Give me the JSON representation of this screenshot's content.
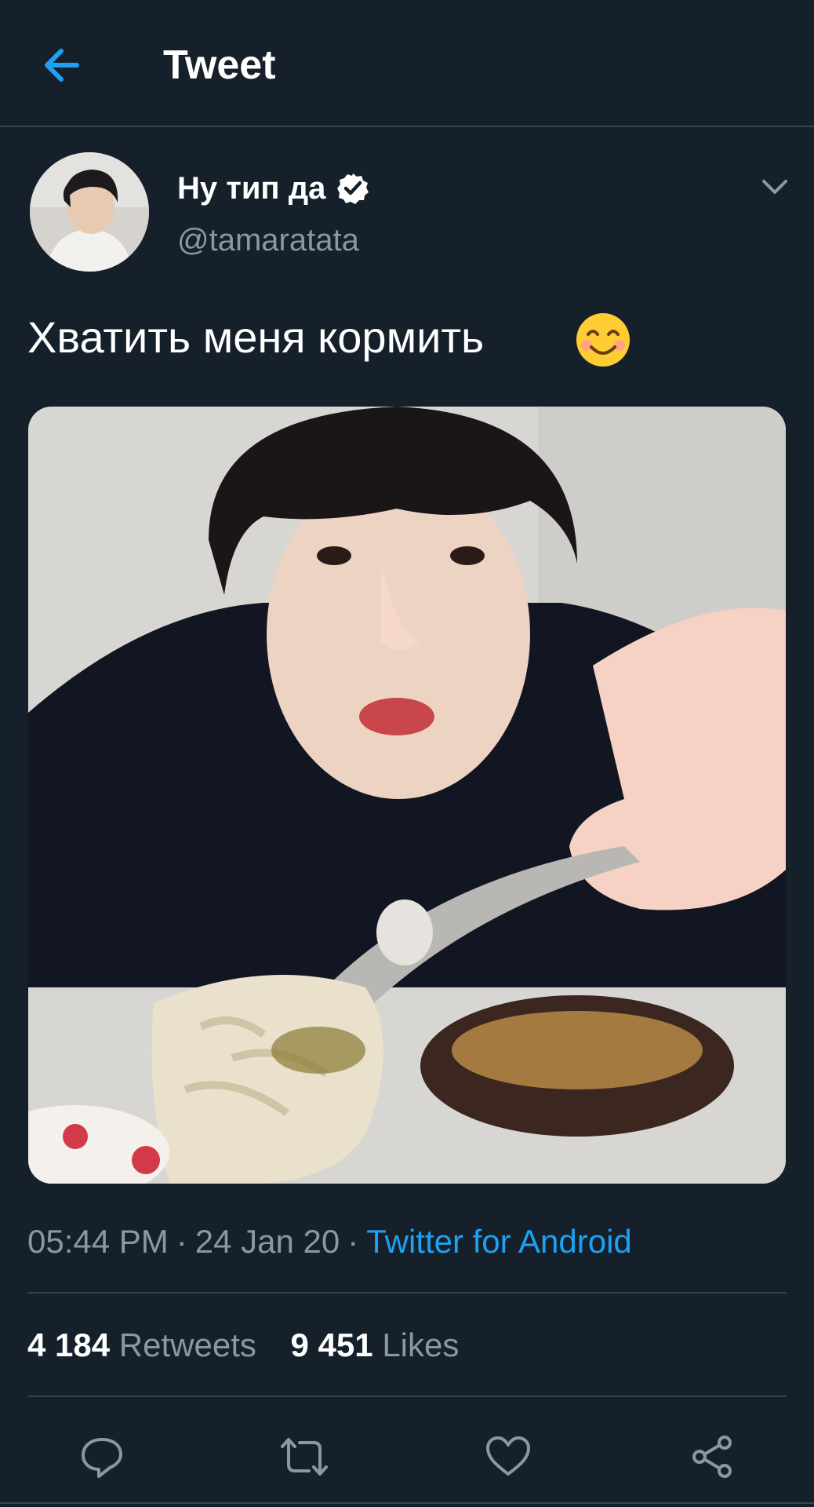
{
  "header": {
    "title": "Tweet"
  },
  "tweet": {
    "author_name": "Ну тип да",
    "author_handle": "@tamaratata",
    "text": "Хватить меня кормить",
    "time": "05:44 PM",
    "date": "24 Jan 20",
    "separator": "·",
    "source": "Twitter for Android",
    "retweets_count": "4 184",
    "retweets_label": "Retweets",
    "likes_count": "9 451",
    "likes_label": "Likes"
  },
  "icons": {
    "back": "arrow-left-icon",
    "verified": "verified-badge-icon",
    "menu": "chevron-down-icon",
    "emoji": "smiling-face-emoji",
    "reply": "reply-icon",
    "retweet": "retweet-icon",
    "like": "heart-icon",
    "share": "share-icon"
  },
  "colors": {
    "background": "#15202b",
    "accent": "#1da1f2",
    "secondary_text": "#8899a6",
    "divider": "#38444d"
  }
}
